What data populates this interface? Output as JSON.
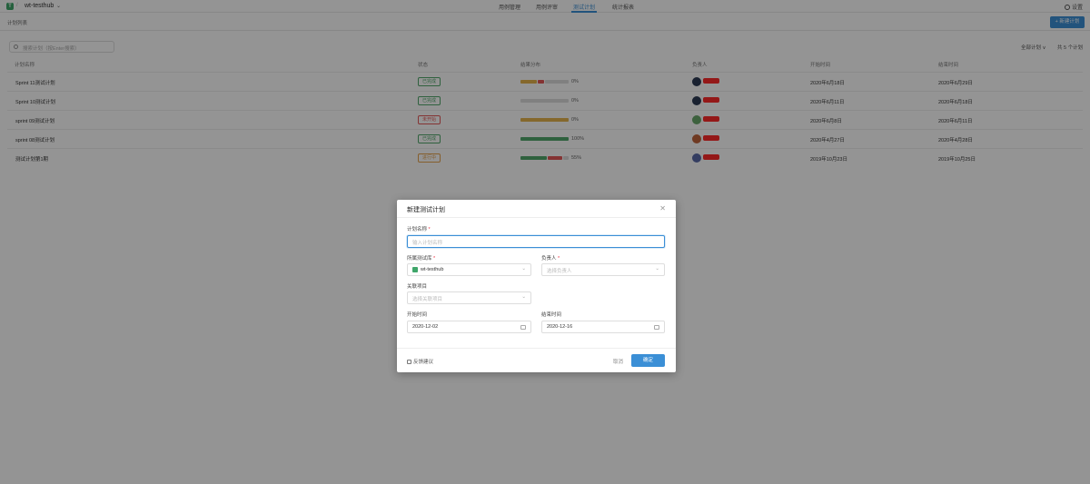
{
  "header": {
    "logo_letter": "T",
    "project_name": "wt-testhub",
    "nav": [
      "用例管理",
      "用例评审",
      "测试计划",
      "统计报表"
    ],
    "active_nav": "测试计划",
    "settings_label": "设置"
  },
  "subheader": {
    "breadcrumb": "计划列表",
    "new_plan_button": "+ 新建计划"
  },
  "toolbar": {
    "search_placeholder": "搜索计划（按Enter搜索）",
    "filter_label": "全部计划 ∨",
    "count_label": "共 5 个计划"
  },
  "table": {
    "columns": [
      "计划名称",
      "状态",
      "结果分布",
      "负责人",
      "开始时间",
      "结束时间"
    ],
    "rows": [
      {
        "name": "Sprint 11测试计划",
        "status": "已完成",
        "status_color": "#52a86b",
        "result_pct": "0%",
        "segments": [
          {
            "w": 18,
            "c": "#e5b44c"
          },
          {
            "w": 7,
            "c": "#e45959"
          },
          {
            "w": 26,
            "c": "#ddd"
          }
        ],
        "avatar_color": "#2d3b55",
        "start": "2020年6月18日",
        "end": "2020年6月29日"
      },
      {
        "name": "Sprint 10测试计划",
        "status": "已完成",
        "status_color": "#52a86b",
        "result_pct": "0%",
        "segments": [
          {
            "w": 53,
            "c": "#ddd"
          }
        ],
        "avatar_color": "#2d3b55",
        "start": "2020年6月11日",
        "end": "2020年6月18日"
      },
      {
        "name": "sprint 09测试计划",
        "status": "未开始",
        "status_color": "#e45959",
        "result_pct": "0%",
        "segments": [
          {
            "w": 53,
            "c": "#e5b44c"
          }
        ],
        "avatar_color": "#6aa86b",
        "start": "2020年6月8日",
        "end": "2020年6月11日"
      },
      {
        "name": "sprint 08测试计划",
        "status": "已完成",
        "status_color": "#52a86b",
        "result_pct": "100%",
        "segments": [
          {
            "w": 53,
            "c": "#52a86b"
          }
        ],
        "avatar_color": "#c0643c",
        "start": "2020年4月27日",
        "end": "2020年4月28日"
      },
      {
        "name": "测试计划第1期",
        "status": "进行中",
        "status_color": "#e5a24c",
        "result_pct": "55%",
        "segments": [
          {
            "w": 29,
            "c": "#52a86b"
          },
          {
            "w": 16,
            "c": "#e45959"
          },
          {
            "w": 6,
            "c": "#ddd"
          }
        ],
        "avatar_color": "#5a6aa8",
        "start": "2019年10月23日",
        "end": "2019年10月25日"
      }
    ]
  },
  "modal": {
    "title": "新建测试计划",
    "name_label": "计划名称",
    "name_placeholder": "输入计划名称",
    "repo_label": "所属测试库",
    "repo_value": "wt-testhub",
    "owner_label": "负责人",
    "owner_placeholder": "选择负责人",
    "project_label": "关联项目",
    "project_placeholder": "选择关联项目",
    "start_label": "开始时间",
    "start_value": "2020-12-02",
    "end_label": "结束时间",
    "end_value": "2020-12-16",
    "feedback": "反馈建议",
    "cancel": "取消",
    "ok": "确定",
    "required_mark": "*",
    "close_glyph": "✕"
  }
}
